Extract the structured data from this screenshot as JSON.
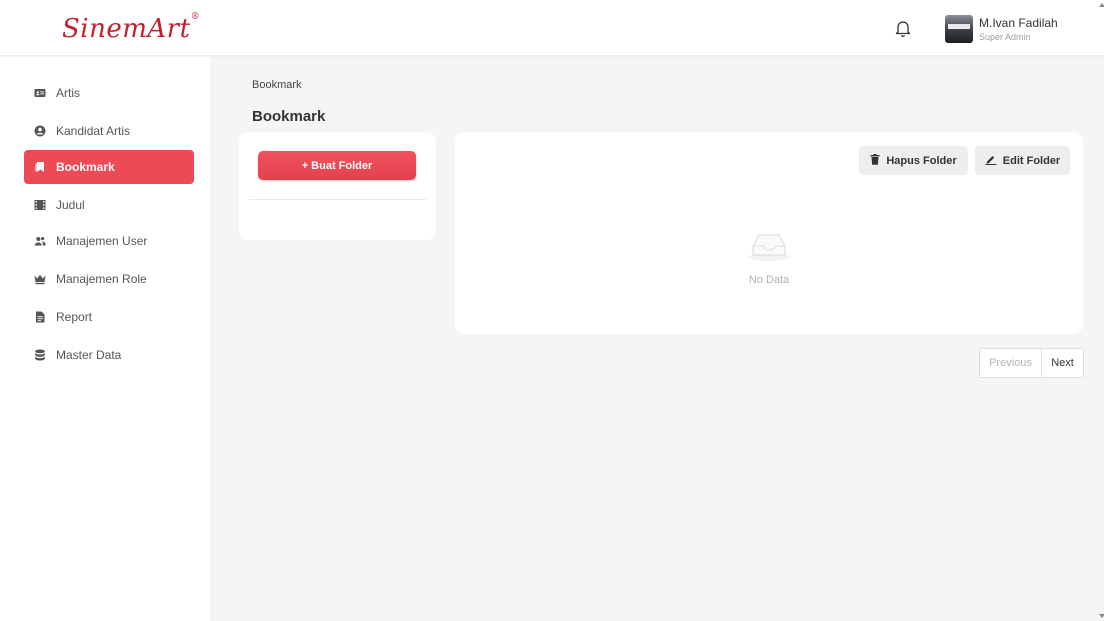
{
  "brand": {
    "name": "SinemArt",
    "mark": "®"
  },
  "user": {
    "name": "M.Ivan Fadilah",
    "role": "Super Admin"
  },
  "sidebar": {
    "items": [
      {
        "label": "Artis",
        "icon": "id-card-icon"
      },
      {
        "label": "Kandidat Artis",
        "icon": "user-circle-icon"
      },
      {
        "label": "Bookmark",
        "icon": "bookmark-icon",
        "active": true
      },
      {
        "label": "Judul",
        "icon": "film-icon"
      },
      {
        "label": "Manajemen User",
        "icon": "users-icon"
      },
      {
        "label": "Manajemen Role",
        "icon": "crown-icon"
      },
      {
        "label": "Report",
        "icon": "file-icon"
      },
      {
        "label": "Master Data",
        "icon": "database-icon"
      }
    ]
  },
  "breadcrumb": "Bookmark",
  "page_title": "Bookmark",
  "folders": {
    "create_label": "+ Buat Folder"
  },
  "toolbar": {
    "delete_label": "Hapus Folder",
    "edit_label": "Edit Folder"
  },
  "empty": {
    "text": "No Data"
  },
  "pagination": {
    "prev_label": "Previous",
    "next_label": "Next"
  },
  "colors": {
    "accent": "#ed4a56",
    "brand": "#c0202f"
  }
}
